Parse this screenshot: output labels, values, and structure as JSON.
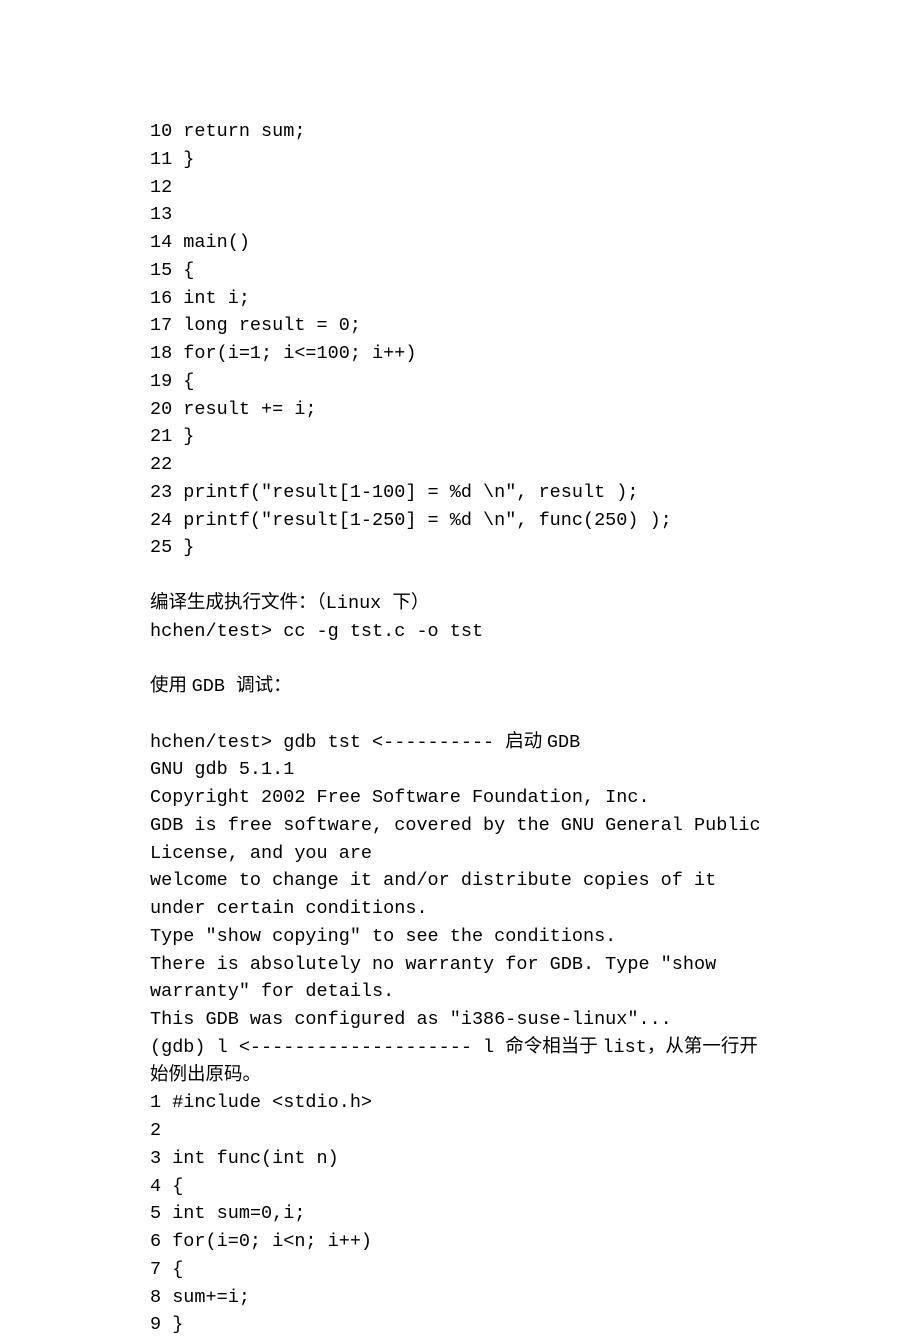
{
  "doc": {
    "lines": [
      {
        "type": "mono",
        "text": "10 return sum;"
      },
      {
        "type": "mono",
        "text": "11 }"
      },
      {
        "type": "mono",
        "text": "12"
      },
      {
        "type": "mono",
        "text": "13"
      },
      {
        "type": "mono",
        "text": "14 main()"
      },
      {
        "type": "mono",
        "text": "15 {"
      },
      {
        "type": "mono",
        "text": "16 int i;"
      },
      {
        "type": "mono",
        "text": "17 long result = 0;"
      },
      {
        "type": "mono",
        "text": "18 for(i=1; i<=100; i++)"
      },
      {
        "type": "mono",
        "text": "19 {"
      },
      {
        "type": "mono",
        "text": "20 result += i;"
      },
      {
        "type": "mono",
        "text": "21 }"
      },
      {
        "type": "mono",
        "text": "22"
      },
      {
        "type": "mono",
        "text": "23 printf(\"result[1-100] = %d \\n\", result );"
      },
      {
        "type": "mono",
        "text": "24 printf(\"result[1-250] = %d \\n\", func(250) );"
      },
      {
        "type": "mono",
        "text": "25 }"
      },
      {
        "type": "blank",
        "text": ""
      },
      {
        "type": "mixed",
        "segments": [
          {
            "cjk": true,
            "text": "编译生成执行文件：（"
          },
          {
            "cjk": false,
            "text": "Linux "
          },
          {
            "cjk": true,
            "text": "下）"
          }
        ]
      },
      {
        "type": "mono",
        "text": "hchen/test> cc -g tst.c -o tst"
      },
      {
        "type": "blank",
        "text": ""
      },
      {
        "type": "mixed",
        "segments": [
          {
            "cjk": true,
            "text": "使用 "
          },
          {
            "cjk": false,
            "text": "GDB "
          },
          {
            "cjk": true,
            "text": "调试："
          }
        ]
      },
      {
        "type": "blank",
        "text": ""
      },
      {
        "type": "mixed",
        "segments": [
          {
            "cjk": false,
            "text": "hchen/test> gdb tst <---------- "
          },
          {
            "cjk": true,
            "text": "启动 "
          },
          {
            "cjk": false,
            "text": "GDB"
          }
        ]
      },
      {
        "type": "mono",
        "text": "GNU gdb 5.1.1"
      },
      {
        "type": "mono",
        "text": "Copyright 2002 Free Software Foundation, Inc."
      },
      {
        "type": "mono",
        "text": "GDB is free software, covered by the GNU General Public License, and you are"
      },
      {
        "type": "mono",
        "text": "welcome to change it and/or distribute copies of it under certain conditions."
      },
      {
        "type": "mono",
        "text": "Type \"show copying\" to see the conditions."
      },
      {
        "type": "mono",
        "text": "There is absolutely no warranty for GDB. Type \"show warranty\" for details."
      },
      {
        "type": "mono",
        "text": "This GDB was configured as \"i386-suse-linux\"..."
      },
      {
        "type": "mixed",
        "segments": [
          {
            "cjk": false,
            "text": "(gdb) l <-------------------- l "
          },
          {
            "cjk": true,
            "text": "命令相当于 "
          },
          {
            "cjk": false,
            "text": "list"
          },
          {
            "cjk": true,
            "text": "，从第一行开始例出原码。"
          }
        ]
      },
      {
        "type": "mono",
        "text": "1 #include <stdio.h>"
      },
      {
        "type": "mono",
        "text": "2"
      },
      {
        "type": "mono",
        "text": "3 int func(int n)"
      },
      {
        "type": "mono",
        "text": "4 {"
      },
      {
        "type": "mono",
        "text": "5 int sum=0,i;"
      },
      {
        "type": "mono",
        "text": "6 for(i=0; i<n; i++)"
      },
      {
        "type": "mono",
        "text": "7 {"
      },
      {
        "type": "mono",
        "text": "8 sum+=i;"
      },
      {
        "type": "mono",
        "text": "9 }"
      }
    ]
  }
}
